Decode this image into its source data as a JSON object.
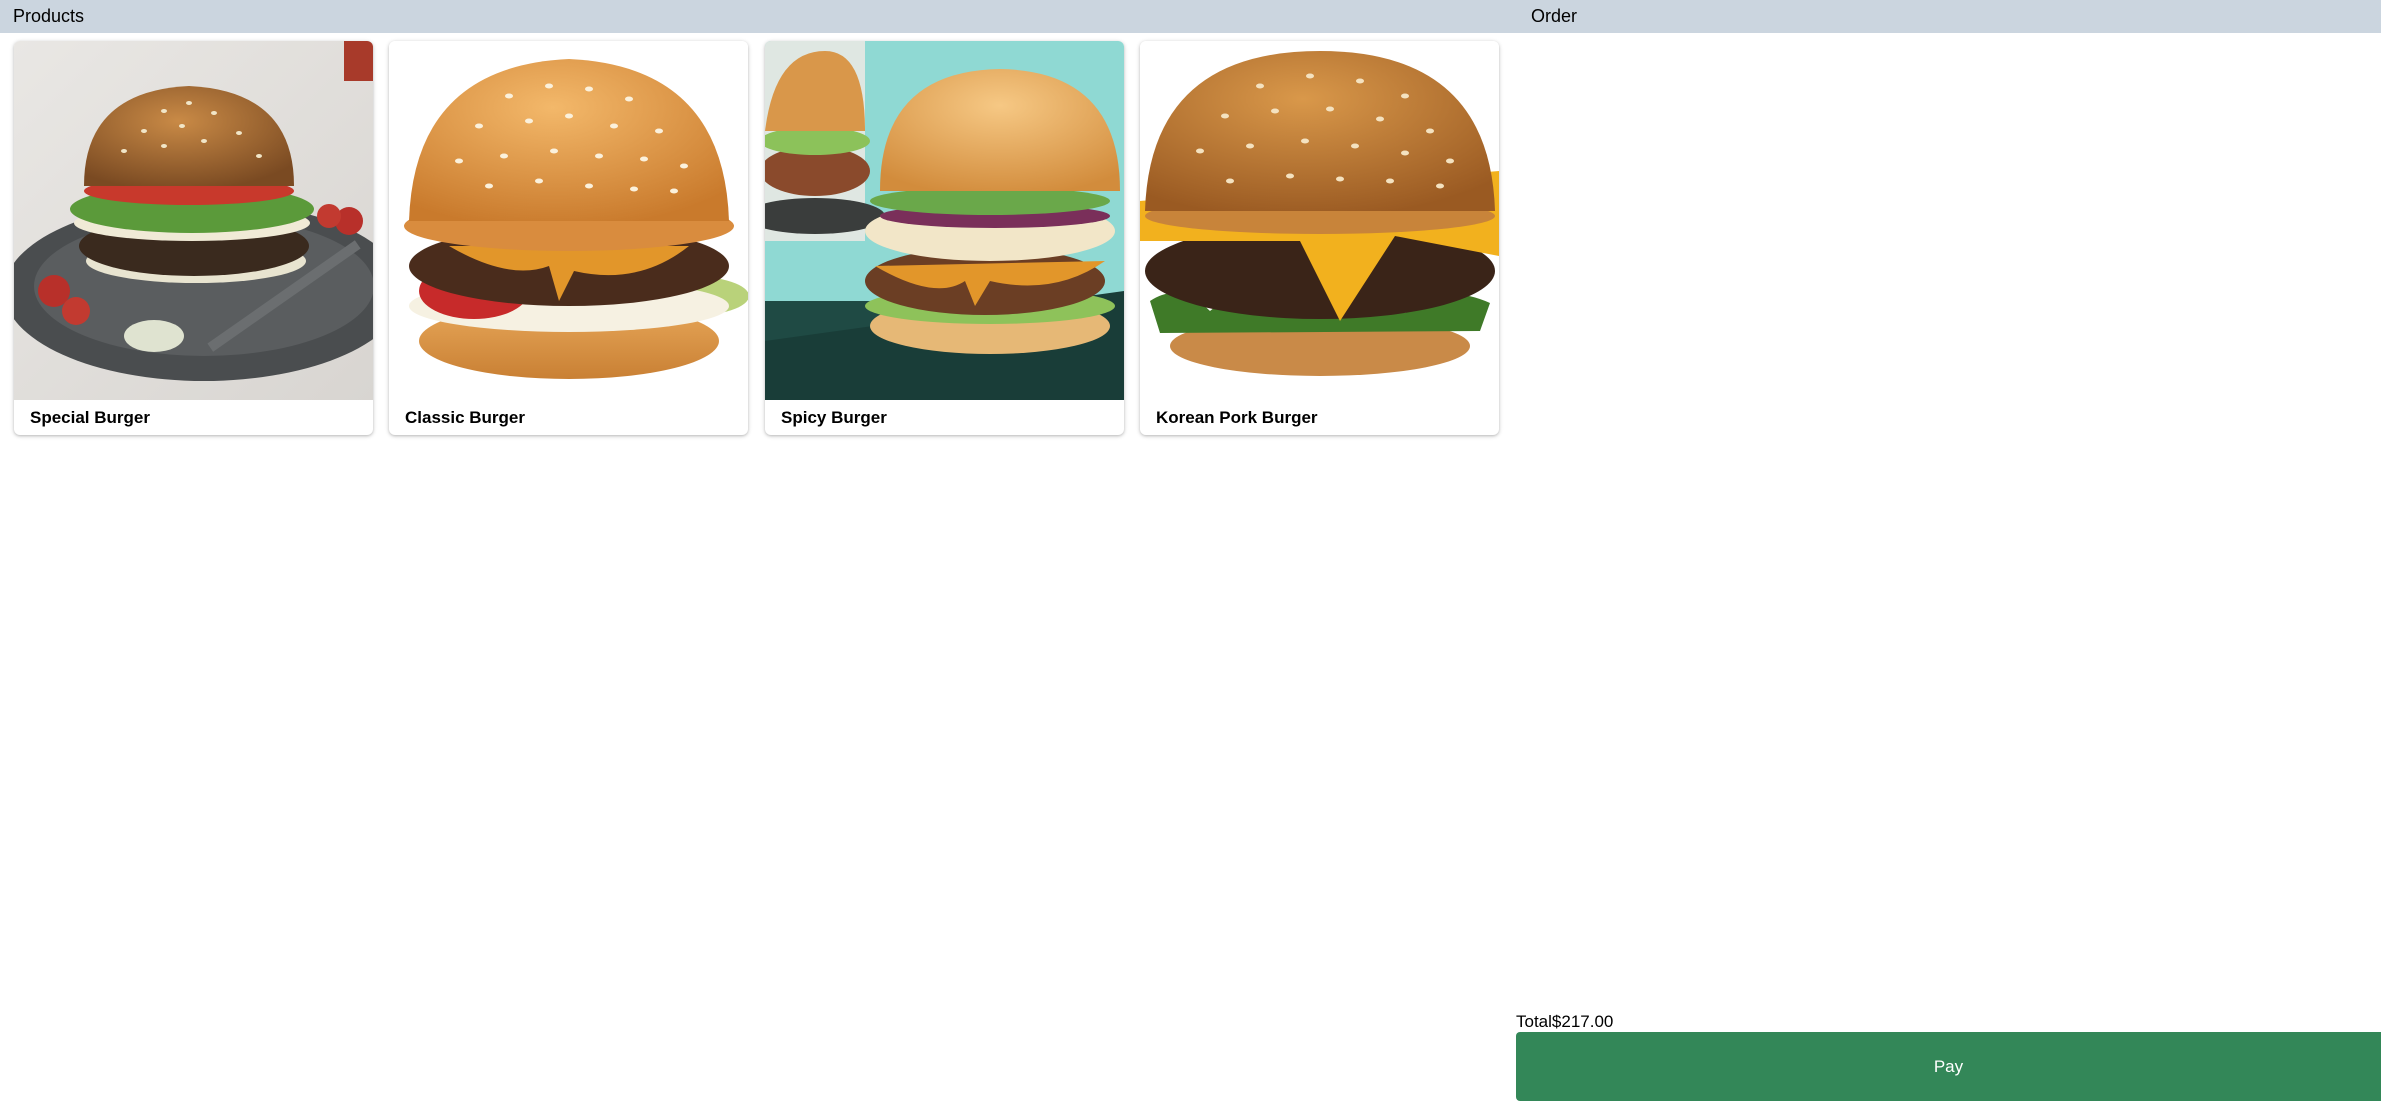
{
  "products_panel": {
    "title": "Products"
  },
  "order_panel": {
    "title": "Order"
  },
  "products": [
    {
      "name": "Special Burger",
      "image": "special-burger-photo"
    },
    {
      "name": "Classic Burger",
      "image": "classic-burger-photo"
    },
    {
      "name": "Spicy Burger",
      "image": "spicy-burger-photo"
    },
    {
      "name": "Korean Pork Burger",
      "image": "korean-pork-burger-photo"
    }
  ],
  "order": {
    "total_label": "Total",
    "total_value": "$217.00",
    "pay_label": "Pay"
  },
  "colors": {
    "header_bg": "#cbd5df",
    "pay_button": "#338758",
    "page_bg": "#ffffff"
  }
}
